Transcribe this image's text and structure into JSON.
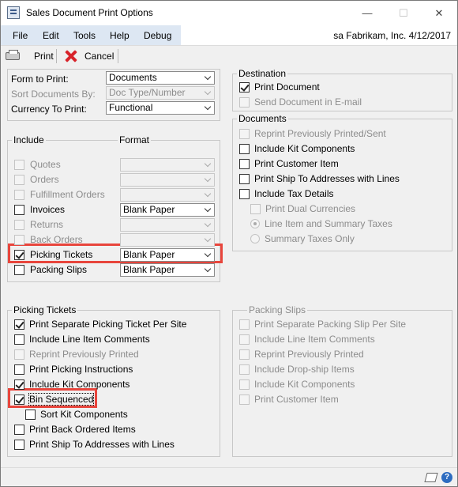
{
  "window": {
    "title": "Sales Document Print Options",
    "minimize": "—",
    "maximize": "☐",
    "close": "✕"
  },
  "menu": {
    "items": [
      "File",
      "Edit",
      "Tools",
      "Help",
      "Debug"
    ],
    "right_info": "sa  Fabrikam, Inc.  4/12/2017"
  },
  "toolbar": {
    "print_label": "Print",
    "cancel_label": "Cancel"
  },
  "form": {
    "form_to_print_label": "Form to Print:",
    "form_to_print_value": "Documents",
    "sort_documents_label": "Sort Documents By:",
    "sort_documents_value": "Doc Type/Number",
    "currency_label": "Currency To Print:",
    "currency_value": "Functional"
  },
  "include": {
    "title": "Include",
    "format_header": "Format",
    "rows": [
      {
        "label": "Quotes",
        "checked": false,
        "enabled": false,
        "format": ""
      },
      {
        "label": "Orders",
        "checked": false,
        "enabled": false,
        "format": ""
      },
      {
        "label": "Fulfillment Orders",
        "checked": false,
        "enabled": false,
        "format": ""
      },
      {
        "label": "Invoices",
        "checked": false,
        "enabled": true,
        "format": "Blank Paper"
      },
      {
        "label": "Returns",
        "checked": false,
        "enabled": false,
        "format": ""
      },
      {
        "label": "Back Orders",
        "checked": false,
        "enabled": false,
        "format": ""
      },
      {
        "label": "Picking Tickets",
        "checked": true,
        "enabled": true,
        "format": "Blank Paper"
      },
      {
        "label": "Packing Slips",
        "checked": false,
        "enabled": true,
        "format": "Blank Paper"
      }
    ]
  },
  "picking_tickets": {
    "title": "Picking Tickets",
    "items": [
      {
        "label": "Print Separate Picking Ticket Per Site",
        "checked": true,
        "enabled": true
      },
      {
        "label": "Include Line Item Comments",
        "checked": false,
        "enabled": true
      },
      {
        "label": "Reprint Previously Printed",
        "checked": false,
        "enabled": false
      },
      {
        "label": "Print Picking Instructions",
        "checked": false,
        "enabled": true
      },
      {
        "label": "Include Kit Components",
        "checked": true,
        "enabled": true
      },
      {
        "label": "Bin Sequenced",
        "checked": true,
        "enabled": true
      },
      {
        "label": "Sort Kit Components",
        "checked": false,
        "enabled": true
      },
      {
        "label": "Print Back Ordered Items",
        "checked": false,
        "enabled": true
      },
      {
        "label": "Print Ship To Addresses with Lines",
        "checked": false,
        "enabled": true
      }
    ]
  },
  "destination": {
    "title": "Destination",
    "items": [
      {
        "label": "Print Document",
        "checked": true,
        "enabled": true
      },
      {
        "label": "Send Document in E-mail",
        "checked": false,
        "enabled": false
      }
    ]
  },
  "documents": {
    "title": "Documents",
    "items": [
      {
        "label": "Reprint Previously Printed/Sent",
        "checked": false,
        "enabled": false
      },
      {
        "label": "Include Kit Components",
        "checked": false,
        "enabled": true
      },
      {
        "label": "Print Customer Item",
        "checked": false,
        "enabled": true
      },
      {
        "label": "Print Ship To Addresses with Lines",
        "checked": false,
        "enabled": true
      },
      {
        "label": "Include Tax Details",
        "checked": false,
        "enabled": true
      },
      {
        "label": "Print Dual Currencies",
        "checked": false,
        "enabled": false
      }
    ],
    "radios": [
      {
        "label": "Line Item and Summary Taxes",
        "selected": true
      },
      {
        "label": "Summary Taxes Only",
        "selected": false
      }
    ]
  },
  "packing_slips": {
    "title": "Packing Slips",
    "items": [
      {
        "label": "Print Separate Packing Slip Per Site",
        "checked": false,
        "enabled": false
      },
      {
        "label": "Include Line Item Comments",
        "checked": false,
        "enabled": false
      },
      {
        "label": "Reprint Previously Printed",
        "checked": false,
        "enabled": false
      },
      {
        "label": "Include Drop-ship Items",
        "checked": false,
        "enabled": false
      },
      {
        "label": "Include Kit Components",
        "checked": false,
        "enabled": false
      },
      {
        "label": "Print Customer Item",
        "checked": false,
        "enabled": false
      }
    ]
  },
  "colors": {
    "highlight": "#e8453c",
    "menu_strip": "#dde7f3"
  }
}
